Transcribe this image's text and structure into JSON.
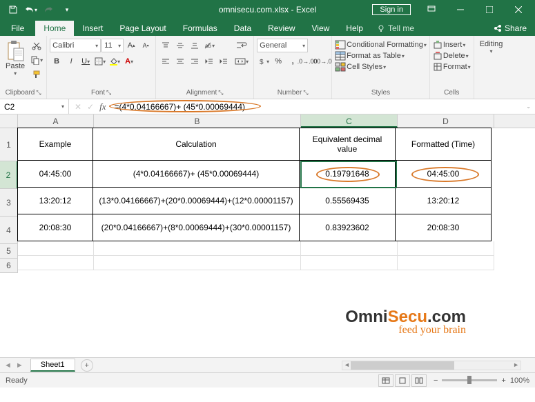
{
  "app": {
    "title": "omnisecu.com.xlsx - Excel",
    "signin": "Sign in"
  },
  "tabs": {
    "file": "File",
    "home": "Home",
    "insert": "Insert",
    "pagelayout": "Page Layout",
    "formulas": "Formulas",
    "data": "Data",
    "review": "Review",
    "view": "View",
    "help": "Help",
    "tellme": "Tell me",
    "share": "Share"
  },
  "ribbon": {
    "paste": "Paste",
    "clipboard": "Clipboard",
    "font_name": "Calibri",
    "font_size": "11",
    "font": "Font",
    "alignment": "Alignment",
    "number_format": "General",
    "number": "Number",
    "cond_format": "Conditional Formatting",
    "format_table": "Format as Table",
    "cell_styles": "Cell Styles",
    "styles": "Styles",
    "insert_btn": "Insert",
    "delete_btn": "Delete",
    "format_btn": "Format",
    "cells": "Cells",
    "editing": "Editing"
  },
  "formula": {
    "cell_ref": "C2",
    "content": "=(4*0.04166667)+ (45*0.00069444)"
  },
  "columns": {
    "A": "A",
    "B": "B",
    "C": "C",
    "D": "D"
  },
  "headers": {
    "example": "Example",
    "calculation": "Calculation",
    "equiv": "Equivalent decimal value",
    "formatted": "Formatted (Time)"
  },
  "rows": [
    {
      "a": "04:45:00",
      "b": "(4*0.04166667)+ (45*0.00069444)",
      "c": "0.19791648",
      "d": "04:45:00"
    },
    {
      "a": "13:20:12",
      "b": "(13*0.04166667)+(20*0.00069444)+(12*0.00001157)",
      "c": "0.55569435",
      "d": "13:20:12"
    },
    {
      "a": "20:08:30",
      "b": "(20*0.04166667)+(8*0.00069444)+(30*0.00001157)",
      "c": "0.83923602",
      "d": "20:08:30"
    }
  ],
  "watermark": {
    "omni": "Omni",
    "secu": "Secu",
    "dotcom": ".com",
    "tag": "feed your brain"
  },
  "sheet": {
    "name": "Sheet1"
  },
  "status": {
    "ready": "Ready",
    "zoom": "100%"
  }
}
